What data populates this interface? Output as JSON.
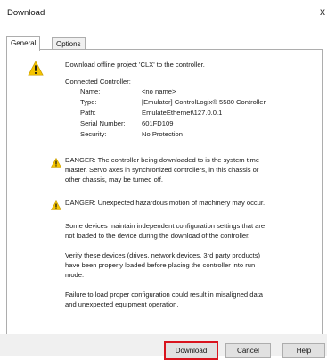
{
  "window": {
    "title": "Download",
    "close_glyph": "x"
  },
  "tabs": [
    {
      "label": "General",
      "active": true
    },
    {
      "label": "Options",
      "active": false
    }
  ],
  "content": {
    "intro": "Download offline project 'CLX' to the controller.",
    "connected_heading": "Connected Controller:",
    "fields": [
      {
        "label": "Name:",
        "value": "<no name>"
      },
      {
        "label": "Type:",
        "value": "[Emulator] ControlLogix® 5580 Controller"
      },
      {
        "label": "Path:",
        "value": "EmulateEthernet\\127.0.0.1"
      },
      {
        "label": "Serial Number:",
        "value": "601FD109"
      },
      {
        "label": "Security:",
        "value": "No Protection"
      }
    ],
    "danger1": [
      "DANGER: The controller being downloaded to is the system time",
      "master.  Servo axes in synchronized controllers, in this chassis or",
      "other chassis, may be turned off."
    ],
    "danger2": "DANGER: Unexpected hazardous motion of machinery may occur.",
    "para1": [
      "Some devices maintain independent configuration settings that are",
      "not loaded to the device during the download of the controller."
    ],
    "para2": [
      "Verify these devices (drives, network devices, 3rd party products)",
      "have been properly loaded before placing the controller into run",
      "mode."
    ],
    "para3": [
      "Failure to load proper configuration could result in misaligned data",
      "and unexpected equipment operation."
    ]
  },
  "buttons": {
    "download": "Download",
    "cancel": "Cancel",
    "help": "Help"
  },
  "icons": {
    "warning": "warning-icon"
  },
  "colors": {
    "warning_fill": "#f5c400",
    "highlight_border": "#d9141e"
  }
}
